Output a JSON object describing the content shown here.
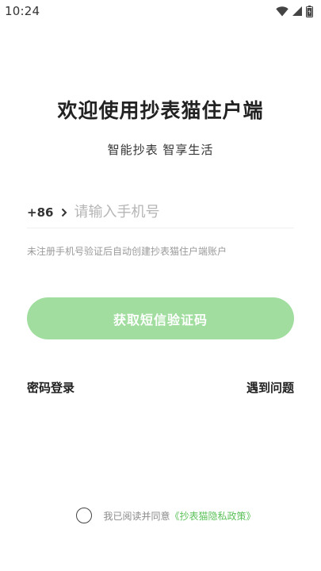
{
  "status_bar": {
    "time": "10:24",
    "icons": [
      "wifi-icon",
      "cellular-signal-icon",
      "battery-icon"
    ]
  },
  "header": {
    "title": "欢迎使用抄表猫住户端",
    "subtitle": "智能抄表  智享生活"
  },
  "phone": {
    "country_code": "+86",
    "placeholder": "请输入手机号",
    "value": ""
  },
  "hint": "未注册手机号验证后自动创建抄表猫住户端账户",
  "sms_button": {
    "label": "获取短信验证码"
  },
  "links": {
    "password_login": "密码登录",
    "help": "遇到问题"
  },
  "agreement": {
    "prefix": "我已阅读并同意",
    "policy": "《抄表猫隐私政策》"
  },
  "colors": {
    "accent": "#a0dd9e",
    "link_green": "#5cc25a",
    "text_dark": "#222222",
    "text_muted": "#9a9a9a"
  }
}
